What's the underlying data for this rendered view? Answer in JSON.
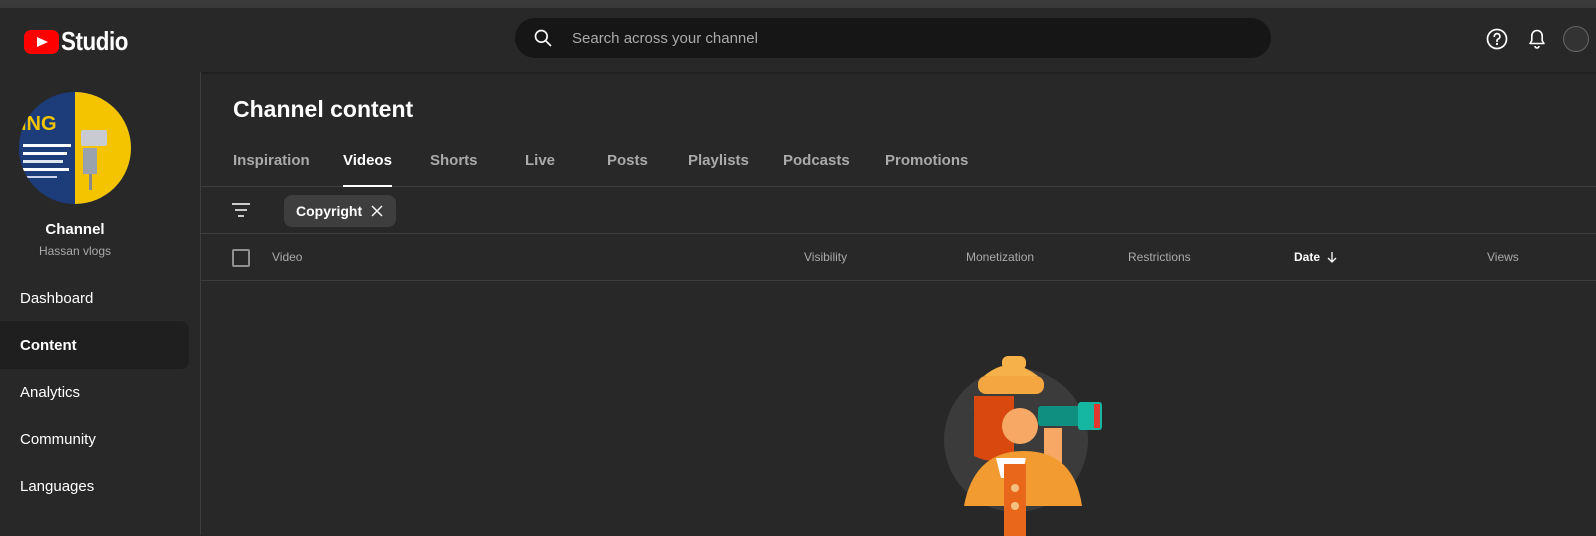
{
  "header": {
    "logo_text": "Studio",
    "search_placeholder": "Search across your channel",
    "icons": [
      "help-icon",
      "bell-icon",
      "account-avatar"
    ]
  },
  "sidebar": {
    "channel_title": "Channel",
    "channel_name": "Hassan vlogs",
    "items": [
      {
        "label": "Dashboard",
        "active": false
      },
      {
        "label": "Content",
        "active": true
      },
      {
        "label": "Analytics",
        "active": false
      },
      {
        "label": "Community",
        "active": false
      },
      {
        "label": "Languages",
        "active": false
      }
    ]
  },
  "main": {
    "title": "Channel content",
    "tabs": [
      {
        "label": "Inspiration",
        "active": false
      },
      {
        "label": "Videos",
        "active": true
      },
      {
        "label": "Shorts",
        "active": false
      },
      {
        "label": "Live",
        "active": false
      },
      {
        "label": "Posts",
        "active": false
      },
      {
        "label": "Playlists",
        "active": false
      },
      {
        "label": "Podcasts",
        "active": false
      },
      {
        "label": "Promotions",
        "active": false
      }
    ],
    "filter_chip": "Copyright",
    "columns": {
      "video": "Video",
      "visibility": "Visibility",
      "monetization": "Monetization",
      "restrictions": "Restrictions",
      "date": "Date",
      "views": "Views"
    }
  },
  "colors": {
    "background": "#282828",
    "accent_red": "#ff0000",
    "text_secondary": "#aaaaaa",
    "divider": "#3e3e3e"
  }
}
